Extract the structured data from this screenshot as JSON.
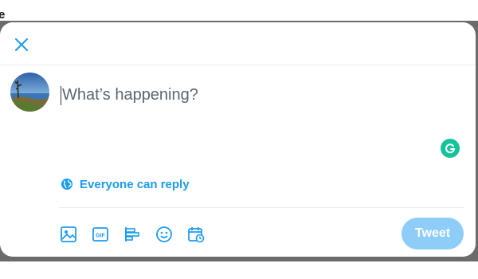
{
  "background": {
    "partial_text": "e"
  },
  "compose": {
    "close_icon": "close-icon",
    "placeholder": "What’s happening?",
    "reply_setting": {
      "icon": "globe-icon",
      "label": "Everyone can reply"
    },
    "toolbar": [
      {
        "name": "media-icon"
      },
      {
        "name": "gif-icon",
        "label": "GIF"
      },
      {
        "name": "poll-icon"
      },
      {
        "name": "emoji-icon"
      },
      {
        "name": "schedule-icon"
      }
    ],
    "submit_label": "Tweet",
    "accent_color": "#1d9bf0",
    "submit_disabled_color": "#8ecdf8",
    "grammarly_color": "#15c39a"
  }
}
